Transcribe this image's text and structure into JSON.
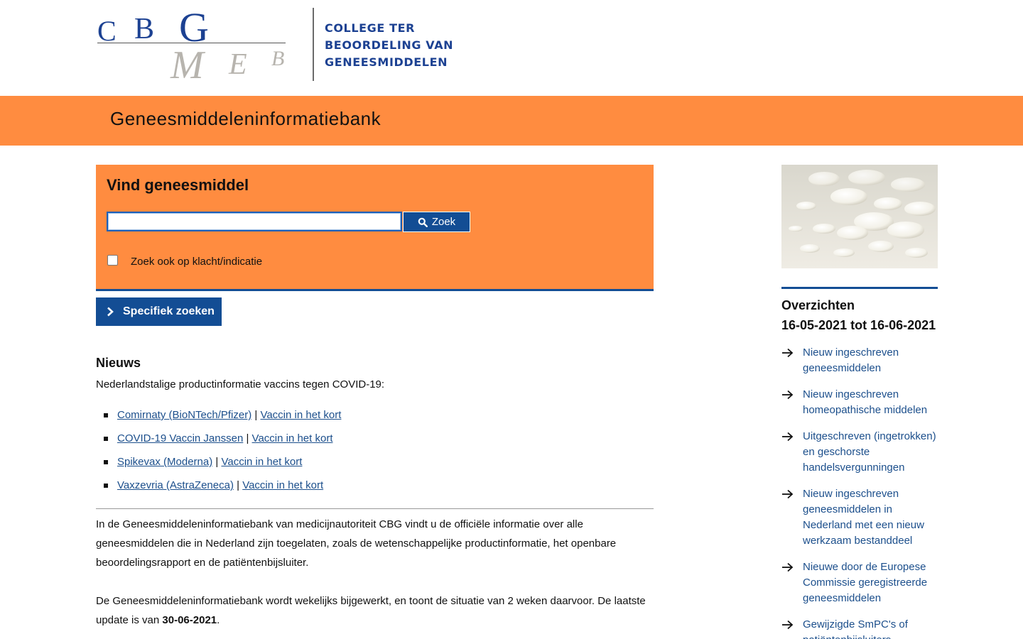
{
  "logo": {
    "letters_top": [
      "C",
      "B",
      "G"
    ],
    "letters_bottom": [
      "M",
      "E",
      "B"
    ],
    "org_lines": [
      "COLLEGE TER",
      "BEOORDELING VAN",
      "GENEESMIDDELEN"
    ]
  },
  "site_title": "Geneesmiddeleninformatiebank",
  "search": {
    "heading": "Vind geneesmiddel",
    "input_value": "",
    "button_label": "Zoek",
    "checkbox_label": "Zoek ook op klacht/indicatie",
    "checkbox_checked": false
  },
  "specific_search_label": "Specifiek zoeken",
  "news": {
    "heading": "Nieuws",
    "intro": "Nederlandstalige productinformatie vaccins tegen COVID-19:",
    "items": [
      {
        "product": "Comirnaty (BioNTech/Pfizer)",
        "sep": " | ",
        "summary": "Vaccin in het kort"
      },
      {
        "product": "COVID-19 Vaccin Janssen",
        "sep": " | ",
        "summary": "Vaccin in het kort"
      },
      {
        "product": "Spikevax (Moderna)",
        "sep": " | ",
        "summary": "Vaccin in het kort"
      },
      {
        "product": "Vaxzevria (AstraZeneca)",
        "sep": " | ",
        "summary": "Vaccin in het kort"
      }
    ]
  },
  "about": {
    "paragraph1": "In de Geneesmiddeleninformatiebank van medicijnautoriteit CBG vindt u de officiële informatie over alle geneesmiddelen die in Nederland zijn toegelaten, zoals de wetenschappelijke productinformatie, het openbare beoordelingsrapport en de patiëntenbijsluiter.",
    "paragraph2_prefix": "De Geneesmiddeleninformatiebank wordt wekelijks bijgewerkt, en toont de situatie van 2 weken daarvoor. De laatste update is van ",
    "update_date": "30-06-2021",
    "paragraph2_suffix": "."
  },
  "sidebar": {
    "title_line1": "Overzichten",
    "title_line2": "16-05-2021 tot 16-06-2021",
    "links": [
      "Nieuw ingeschreven geneesmiddelen",
      "Nieuw ingeschreven homeopathische middelen",
      "Uitgeschreven (ingetrokken) en geschorste handelsvergunningen",
      "Nieuw ingeschreven geneesmiddelen in Nederland met een nieuw werkzaam bestanddeel",
      "Nieuwe door de Europese Commissie geregistreerde geneesmiddelen",
      "Gewijzigde SmPC's of patiëntenbijsluiters"
    ]
  },
  "colors": {
    "orange": "#ff8c40",
    "navy": "#134d94",
    "link": "#1c4f8c",
    "logo_blue": "#1c4192"
  }
}
